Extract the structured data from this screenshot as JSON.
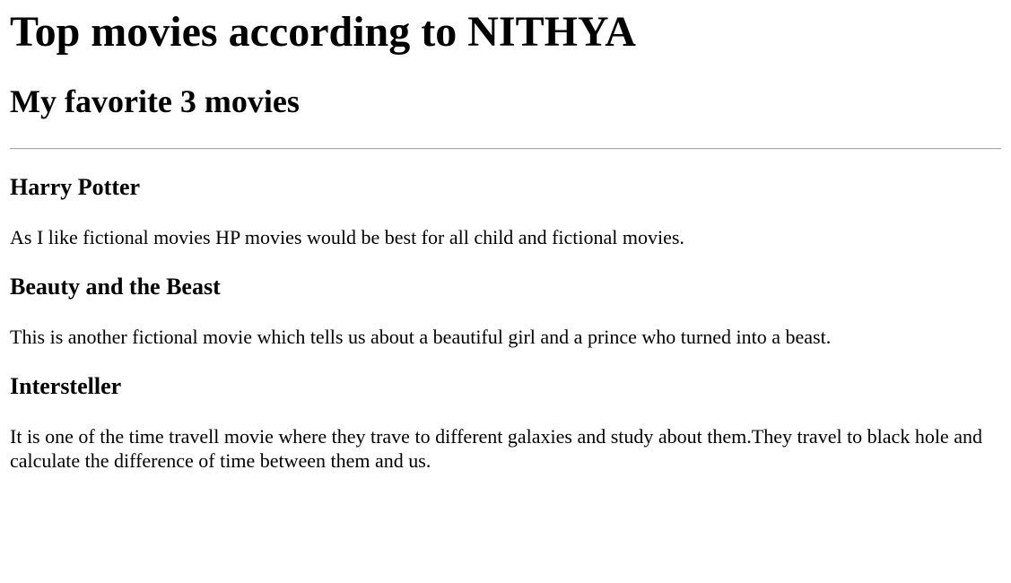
{
  "page": {
    "title": "Top movies according to NITHYA",
    "subtitle": "My favorite 3 movies"
  },
  "movies": [
    {
      "title": "Harry Potter",
      "description": "As I like fictional movies HP movies would be best for all child and fictional movies."
    },
    {
      "title": "Beauty and the Beast",
      "description": "This is another fictional movie which tells us about a beautiful girl and a prince who turned into a beast."
    },
    {
      "title": "Intersteller",
      "description": "It is one of the time travell movie where they trave to different galaxies and study about them.They travel to black hole and calculate the difference of time between them and us."
    }
  ]
}
